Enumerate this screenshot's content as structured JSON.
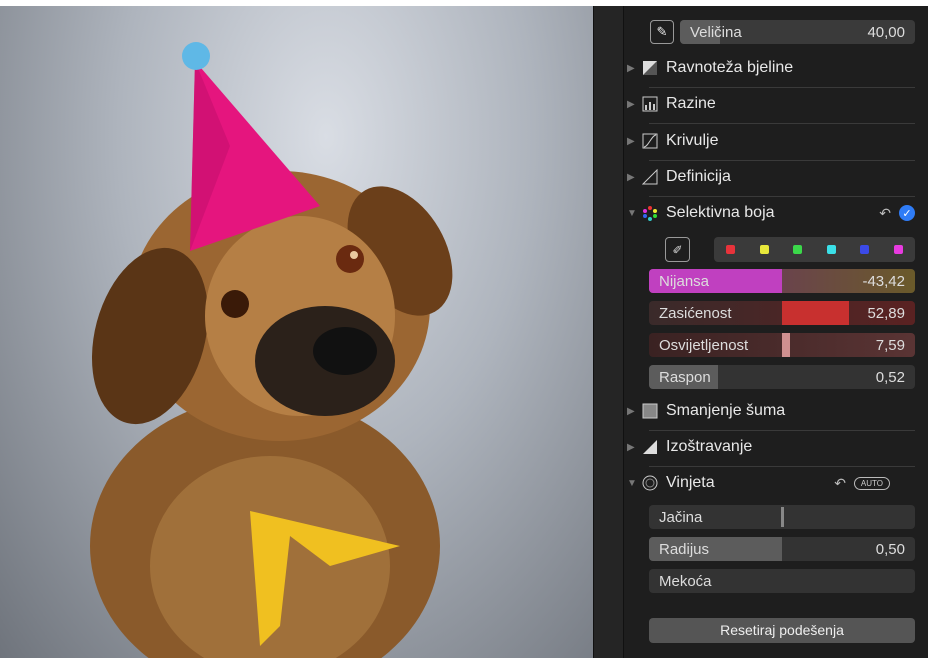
{
  "brush_size": {
    "label": "Veličina",
    "value": "40,00"
  },
  "sections": {
    "white_balance": "Ravnoteža bjeline",
    "levels": "Razine",
    "curves": "Krivulje",
    "definition": "Definicija",
    "selective_color": "Selektivna boja",
    "noise_reduction": "Smanjenje šuma",
    "sharpen": "Izoštravanje",
    "vignette": "Vinjeta"
  },
  "selective_color": {
    "swatch_colors": [
      "#e8333b",
      "#e8e83b",
      "#3bd84a",
      "#3be0e8",
      "#3b4ae8",
      "#e83be0"
    ],
    "hue": {
      "label": "Nijansa",
      "value": "-43,42",
      "level": 0.5
    },
    "saturation": {
      "label": "Zasićenost",
      "value": "52,89",
      "level": 0.75
    },
    "luminance": {
      "label": "Osvijetljenost",
      "value": "7,59",
      "level": 0.53
    },
    "range": {
      "label": "Raspon",
      "value": "0,52",
      "level": 0.26
    }
  },
  "vignette": {
    "auto_label": "AUTO",
    "strength": {
      "label": "Jačina",
      "level": 0.5
    },
    "radius": {
      "label": "Radijus",
      "value": "0,50",
      "level": 0.5
    },
    "softness": {
      "label": "Mekoća"
    }
  },
  "reset_label": "Resetiraj podešenja",
  "colors": {
    "accent": "#2f7cf6"
  }
}
